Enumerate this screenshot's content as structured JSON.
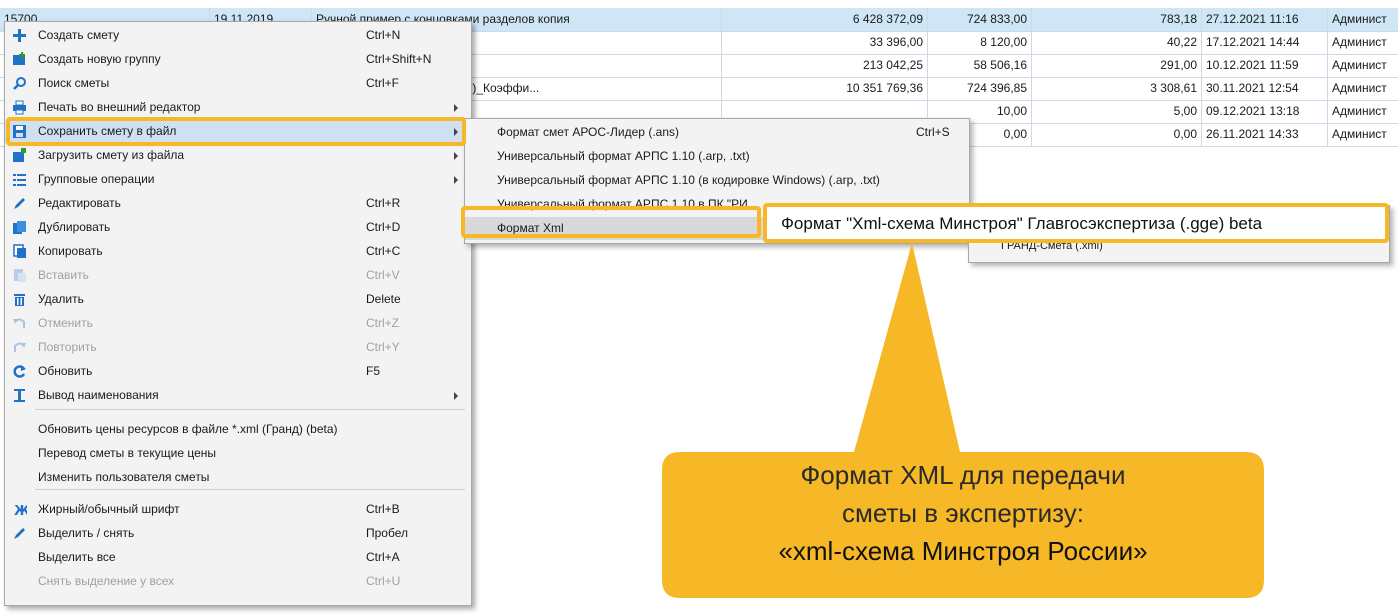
{
  "table": {
    "rows": [
      {
        "id": "15700",
        "date": "19.11.2019",
        "name": "Ручной пример с концовками разделов копия",
        "total": "6 428 372,09",
        "sum2": "724 833,00",
        "sum3": "783,18",
        "modified": "27.12.2021 11:16",
        "user": "Админист",
        "selected": true
      },
      {
        "id": "",
        "date": "",
        "name": "",
        "total": "33 396,00",
        "sum2": "8 120,00",
        "sum3": "40,22",
        "modified": "17.12.2021 14:44",
        "user": "Админист",
        "selected": false
      },
      {
        "id": "",
        "date": "",
        "name": "",
        "total": "213 042,25",
        "sum2": "58 506,16",
        "sum3": "291,00",
        "modified": "10.12.2021 11:59",
        "user": "Админист",
        "selected": false
      },
      {
        "id": "",
        "date": "",
        "name": "локальной сметы (тестовый)_Коэффи...",
        "total": "10 351 769,36",
        "sum2": "724 396,85",
        "sum3": "3 308,61",
        "modified": "30.11.2021 12:54",
        "user": "Админист",
        "selected": false
      },
      {
        "id": "",
        "date": "",
        "name": "",
        "total": "",
        "sum2": "10,00",
        "sum3": "5,00",
        "modified": "09.12.2021 13:18",
        "user": "Админист",
        "selected": false
      },
      {
        "id": "",
        "date": "",
        "name": "",
        "total": "",
        "sum2": "0,00",
        "sum3": "0,00",
        "modified": "26.11.2021 14:33",
        "user": "Админист",
        "selected": false
      }
    ]
  },
  "menu": {
    "items": [
      {
        "icon": "plus-icon",
        "label": "Создать смету",
        "shortcut": "Ctrl+N",
        "disabled": false,
        "submenu": false
      },
      {
        "icon": "new-group-icon",
        "label": "Создать новую группу",
        "shortcut": "Ctrl+Shift+N",
        "disabled": false,
        "submenu": false
      },
      {
        "icon": "search-icon",
        "label": "Поиск сметы",
        "shortcut": "Ctrl+F",
        "disabled": false,
        "submenu": false
      },
      {
        "icon": "print-icon",
        "label": "Печать во внешний редактор",
        "shortcut": "",
        "disabled": false,
        "submenu": true
      },
      {
        "icon": "save-icon",
        "label": "Сохранить смету в файл",
        "shortcut": "",
        "disabled": false,
        "submenu": true,
        "highlighted": true
      },
      {
        "icon": "load-icon",
        "label": "Загрузить смету из файла",
        "shortcut": "",
        "disabled": false,
        "submenu": true
      },
      {
        "icon": "list-icon",
        "label": "Групповые операции",
        "shortcut": "",
        "disabled": false,
        "submenu": true
      },
      {
        "icon": "pencil-icon",
        "label": "Редактировать",
        "shortcut": "Ctrl+R",
        "disabled": false,
        "submenu": false
      },
      {
        "icon": "duplicate-icon",
        "label": "Дублировать",
        "shortcut": "Ctrl+D",
        "disabled": false,
        "submenu": false
      },
      {
        "icon": "copy-icon",
        "label": "Копировать",
        "shortcut": "Ctrl+C",
        "disabled": false,
        "submenu": false
      },
      {
        "icon": "paste-icon",
        "label": "Вставить",
        "shortcut": "Ctrl+V",
        "disabled": true,
        "submenu": false
      },
      {
        "icon": "trash-icon",
        "label": "Удалить",
        "shortcut": "Delete",
        "disabled": false,
        "submenu": false
      },
      {
        "icon": "undo-icon",
        "label": "Отменить",
        "shortcut": "Ctrl+Z",
        "disabled": true,
        "submenu": false
      },
      {
        "icon": "redo-icon",
        "label": "Повторить",
        "shortcut": "Ctrl+Y",
        "disabled": true,
        "submenu": false
      },
      {
        "icon": "refresh-icon",
        "label": "Обновить",
        "shortcut": "F5",
        "disabled": false,
        "submenu": false
      },
      {
        "icon": "text-cursor-icon",
        "label": "Вывод наименования",
        "shortcut": "",
        "disabled": false,
        "submenu": true
      },
      {
        "icon": "",
        "label": "Обновить цены ресурсов в файле *.xml (Гранд) (beta)",
        "shortcut": "",
        "disabled": false,
        "submenu": false
      },
      {
        "icon": "",
        "label": "Перевод сметы в текущие цены",
        "shortcut": "",
        "disabled": false,
        "submenu": false
      },
      {
        "icon": "",
        "label": "Изменить пользователя сметы",
        "shortcut": "",
        "disabled": false,
        "submenu": false
      },
      {
        "icon": "bold-icon",
        "label": "Жирный/обычный шрифт",
        "shortcut": "Ctrl+B",
        "disabled": false,
        "submenu": false
      },
      {
        "icon": "check-pen-icon",
        "label": "Выделить / снять",
        "shortcut": "Пробел",
        "disabled": false,
        "submenu": false
      },
      {
        "icon": "",
        "label": "Выделить все",
        "shortcut": "Ctrl+A",
        "disabled": false,
        "submenu": false
      },
      {
        "icon": "",
        "label": "Снять выделение у всех",
        "shortcut": "Ctrl+U",
        "disabled": true,
        "submenu": false
      }
    ]
  },
  "submenu": {
    "items": [
      {
        "label": "Формат смет АРОС-Лидер (.ans)",
        "shortcut": "Ctrl+S"
      },
      {
        "label": "Универсальный формат АРПС 1.10 (.arp, .txt)",
        "shortcut": ""
      },
      {
        "label": "Универсальный формат АРПС 1.10 (в кодировке Windows) (.arp, .txt)",
        "shortcut": ""
      },
      {
        "label": "Универсальный формат АРПС 1.10 в ПК \"РИ",
        "shortcut": ""
      },
      {
        "label": "Формат Xml",
        "shortcut": ""
      }
    ]
  },
  "subsubmenu": {
    "highlight": "Формат \"Xml-схема Минстроя\" Главгосэкспертиза (.gge) beta",
    "items": [
      {
        "label": "ГРАНД-Смета (.xml)"
      }
    ]
  },
  "callout": {
    "line1": "Формат XML для передачи",
    "line2": "сметы в экспертизу:",
    "line3": "«xml-схема Минстроя России»"
  },
  "colors": {
    "accent": "#f6b826",
    "selection": "#cfe6f7",
    "menu_bg": "#f3f3f3",
    "icon_blue": "#1e72c8"
  }
}
